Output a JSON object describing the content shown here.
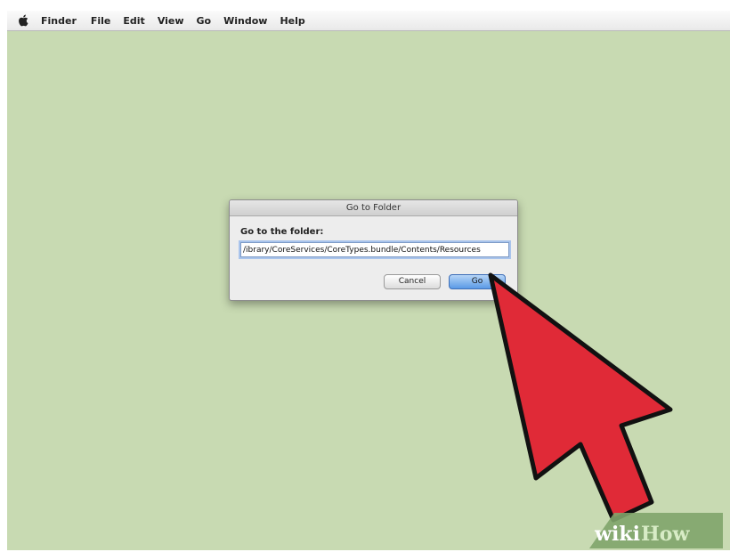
{
  "menubar": {
    "app_name": "Finder",
    "items": [
      "File",
      "Edit",
      "View",
      "Go",
      "Window",
      "Help"
    ]
  },
  "dialog": {
    "title": "Go to Folder",
    "label": "Go to the folder:",
    "path_value": "/System/Library/CoreServices/CoreTypes.bundle/Contents/Resources/",
    "path_visible": "ibrary/CoreServices/CoreTypes.bundle/Contents/Resources/",
    "cancel_label": "Cancel",
    "go_label": "Go"
  },
  "overlay": {
    "arrow_color": "#e02a37",
    "watermark_wiki": "wiki",
    "watermark_how": "How"
  },
  "colors": {
    "desktop": "#c8dab2",
    "accent": "#5a9ae6"
  }
}
